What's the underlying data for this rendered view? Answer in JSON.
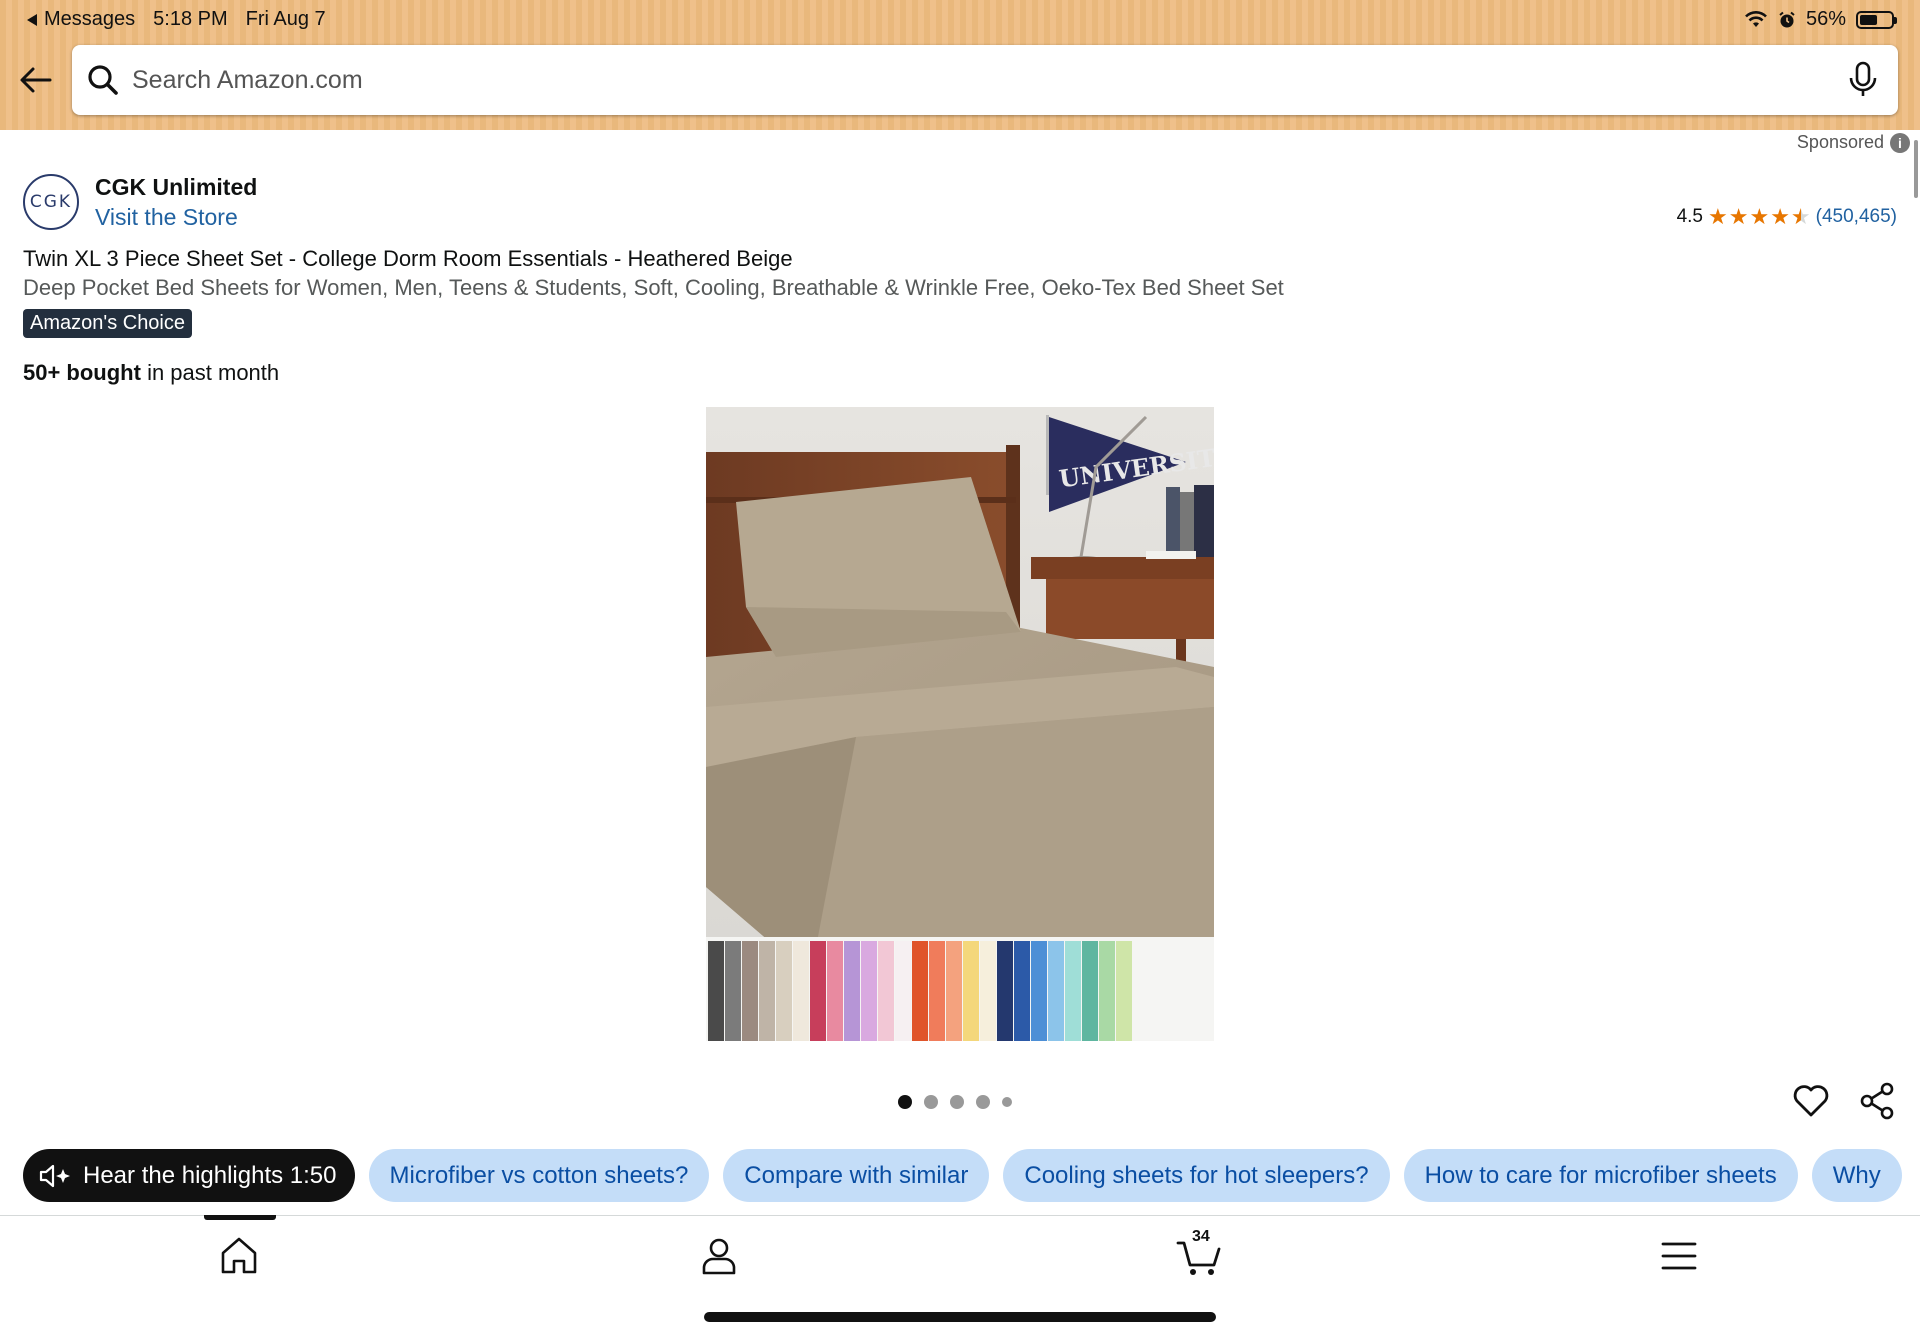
{
  "status_bar": {
    "back_app": "Messages",
    "time": "5:18 PM",
    "date": "Fri Aug 7",
    "battery": "56%",
    "battery_level": 0.56
  },
  "search": {
    "placeholder": "Search Amazon.com"
  },
  "sponsored_label": "Sponsored",
  "store": {
    "logo_text": "CGK",
    "brand": "CGK Unlimited",
    "visit_label": "Visit the Store"
  },
  "rating": {
    "value": "4.5",
    "stars": 4.5,
    "count": "(450,465)"
  },
  "product": {
    "title": "Twin XL 3 Piece Sheet Set - College Dorm Room Essentials - Heathered Beige",
    "subtitle": "Deep Pocket Bed Sheets for Women, Men, Teens & Students, Soft, Cooling, Breathable & Wrinkle Free, Oeko-Tex Bed Sheet Set",
    "badge": "Amazon's Choice",
    "bought_bold": "50+ bought",
    "bought_rest": " in past month",
    "pennant_text": "UNIVERSITY"
  },
  "carousel": {
    "image_count": 5,
    "active_index": 0
  },
  "chips": [
    "Hear the highlights 1:50",
    "Microfiber vs cotton sheets?",
    "Compare with similar",
    "Cooling sheets for hot sleepers?",
    "How to care for microfiber sheets",
    "Why"
  ],
  "nav": {
    "cart_count": "34",
    "items": [
      "home-icon",
      "account-icon",
      "cart-icon",
      "menu-icon"
    ]
  },
  "colors": {
    "header": "#efc08a",
    "link": "#2162a1",
    "chip": "#c4ddf8",
    "star": "#e77600",
    "badge": "#232f3e"
  }
}
